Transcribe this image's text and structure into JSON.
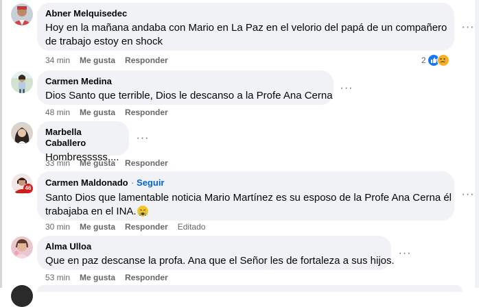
{
  "comments": [
    {
      "author": "Abner Melquisedec",
      "line1": "Hoy en la mañana andaba con Mario en La Paz en el velorio del papá de un compañero",
      "line2": "de trabajo estoy en shock",
      "time": "34 min",
      "like": "Me gusta",
      "reply": "Responder",
      "reaction_count": "2"
    },
    {
      "author": "Carmen Medina",
      "line1": "Dios Santo que terrible, Dios le descanso a la Profe Ana Cerna",
      "time": "48 min",
      "like": "Me gusta",
      "reply": "Responder"
    },
    {
      "author": "Marbella Caballero",
      "line1": "Hombresssss....",
      "time": "33 min",
      "like": "Me gusta",
      "reply": "Responder"
    },
    {
      "author": "Carmen Maldonado",
      "follow": "Seguir",
      "line1": "Santo Dios que lamentable noticia Mario Martínez es su esposo de la Profe Ana Cerna él",
      "line2": "trabajaba en el INA.",
      "time": "30 min",
      "like": "Me gusta",
      "reply": "Responder",
      "edited": "Editado",
      "badge": "46"
    },
    {
      "author": "Alma Ulloa",
      "line1": "Que en paz descanse la profa. Ana que el Señor les de fortaleza a sus hijos.",
      "time": "53 min",
      "like": "Me gusta",
      "reply": "Responder"
    }
  ],
  "more_options": "···",
  "colors": {
    "bubble": "#f0f2f5",
    "link": "#0064d1",
    "meta": "#65676b",
    "like": "#1877f2",
    "sad": "#f7b125"
  },
  "icons": [
    "like-reaction-icon",
    "sad-reaction-icon",
    "more-options-icon",
    "crying-emoji-icon"
  ]
}
